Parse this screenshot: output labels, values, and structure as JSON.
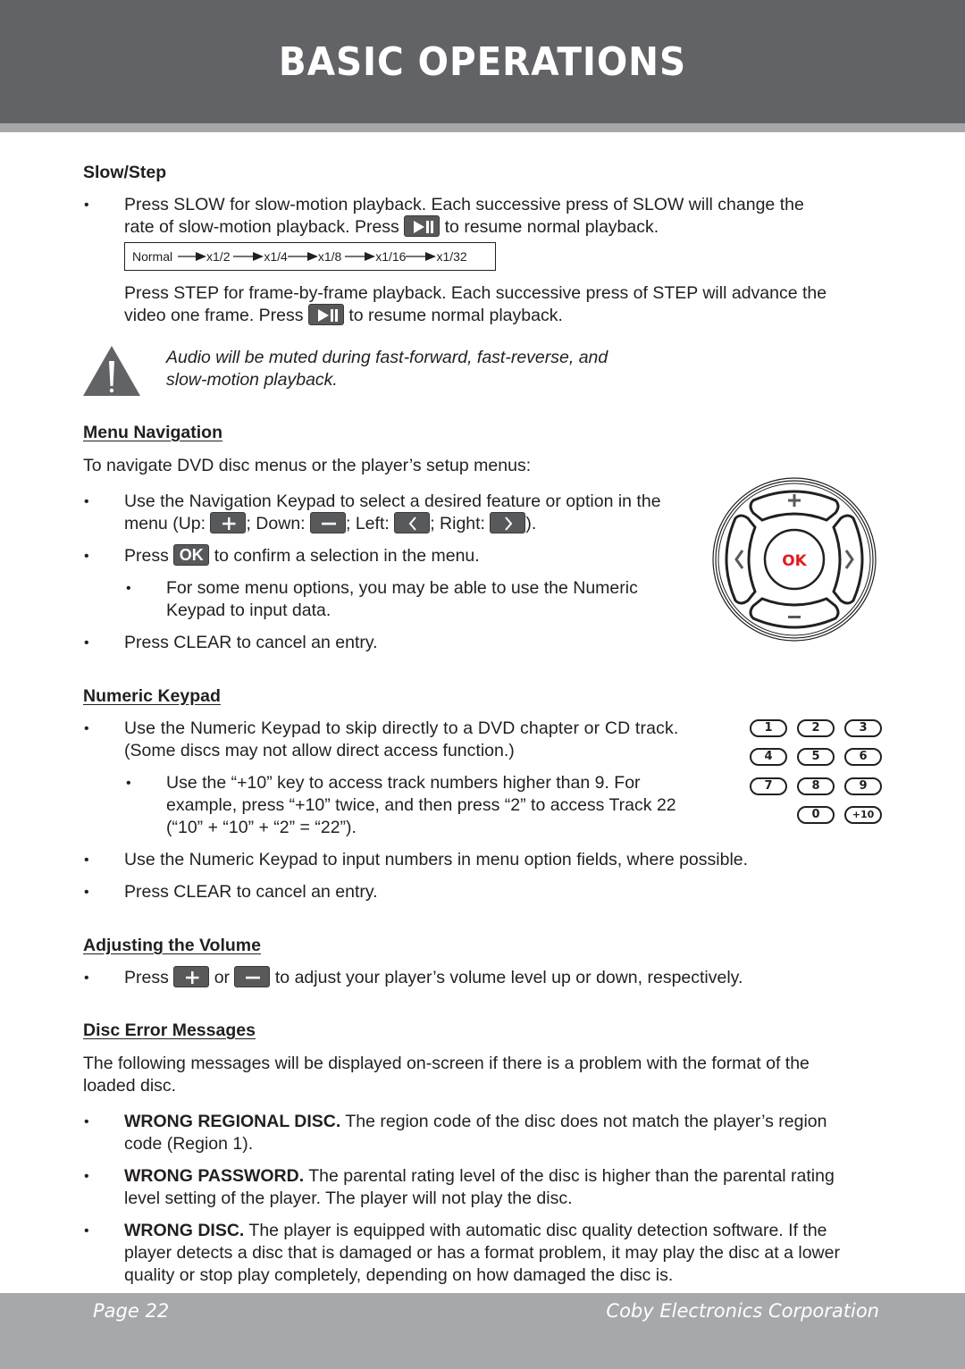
{
  "header": {
    "title": "BASIC OPERATIONS"
  },
  "slow_step": {
    "heading": "Slow/Step",
    "p1_line1": "Press SLOW for slow-motion playback. Each successive press of SLOW will change the",
    "p1_line2_pre": "rate of slow-motion playback. Press",
    "p1_line2_post": "to resume normal playback.",
    "speeds": [
      "Normal",
      "x1/2",
      "x1/4",
      "x1/8",
      "x1/16",
      "x1/32"
    ],
    "p2_line1": "Press STEP for frame-by-frame playback. Each successive press of STEP will advance the",
    "p2_line2_pre": "video one frame. Press",
    "p2_line2_post": "to resume normal playback.",
    "warning_line1": "Audio will be muted during fast-forward, fast-reverse, and",
    "warning_line2": "slow-motion playback."
  },
  "menu_nav": {
    "heading": "Menu Navigation",
    "intro": "To navigate DVD disc menus or the player’s setup menus:",
    "b1_line1": "Use the Navigation Keypad to select a desired feature or option in the",
    "b1_up": "menu (Up:",
    "b1_down": "; Down:",
    "b1_left": "; Left:",
    "b1_right": "; Right:",
    "b1_end": ").",
    "b2_pre": "Press",
    "ok_label": "OK",
    "b2_post": "to confirm a selection in the menu.",
    "sub_line1": "For some menu options, you may be able to use the Numeric",
    "sub_line2": "Keypad to input data.",
    "b3": "Press CLEAR to cancel an entry.",
    "keypad_ok": "OK",
    "keypad_ok_color": "#e31b23"
  },
  "numeric": {
    "heading": "Numeric Keypad",
    "b1_line1": "Use the Numeric Keypad to skip directly to a DVD chapter or CD track.",
    "b1_line2": "(Some discs may not allow direct access function.)",
    "sub_line1": "Use the “+10” key to access track numbers higher than 9. For",
    "sub_line2": "example,  press “+10” twice, and then press “2” to access Track 22",
    "sub_line3": "(“10” + “10” + “2” = “22”).",
    "b2": "Use the Numeric Keypad to input numbers in menu option fields, where possible.",
    "b3": "Press CLEAR to cancel an entry.",
    "keys": [
      "1",
      "2",
      "3",
      "4",
      "5",
      "6",
      "7",
      "8",
      "9",
      "0",
      "+10"
    ]
  },
  "volume": {
    "heading": "Adjusting the Volume",
    "pre": "Press",
    "mid": "or",
    "post": "to adjust your player’s volume level up or down, respectively."
  },
  "errors": {
    "heading": "Disc Error Messages",
    "intro_line1": "The following messages will be displayed on-screen if there is a problem with the format of the",
    "intro_line2": "loaded disc.",
    "items": [
      {
        "title": "WRONG REGIONAL DISC.",
        "line1": " The region code of the disc does not match the player’s region",
        "line2": "code (Region 1)."
      },
      {
        "title": "WRONG PASSWORD.",
        "line1": " The parental rating level of the disc is higher than the parental rating",
        "line2": "level setting of the player. The player will not play the disc."
      },
      {
        "title": "WRONG DISC.",
        "line1": " The player is equipped with automatic disc quality detection software. If the",
        "line2": "player detects a disc that is damaged or has a format problem, it may play the disc at a lower",
        "line3": "quality or stop play completely, depending on how damaged the disc is."
      }
    ]
  },
  "footer": {
    "page": "Page 22",
    "company": "Coby Electronics Corporation"
  }
}
